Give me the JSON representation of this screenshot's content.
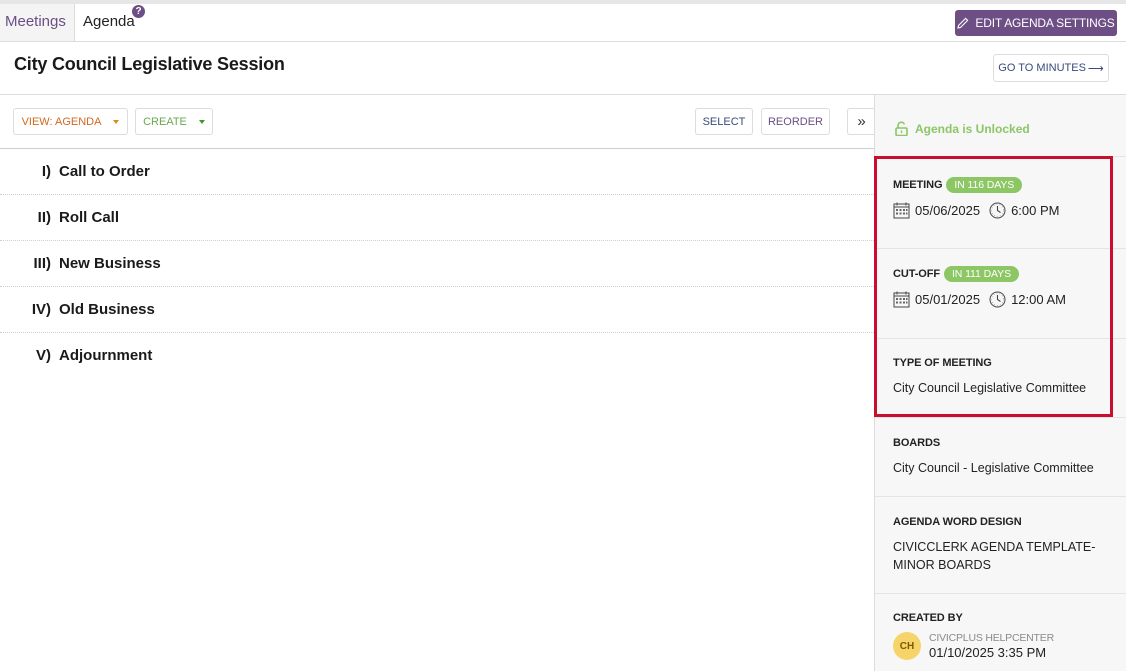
{
  "tabs": {
    "meetings": "Meetings",
    "agenda": "Agenda",
    "help_badge": "?"
  },
  "header": {
    "edit_settings_label": "EDIT AGENDA SETTINGS",
    "edit_settings_icon": "pencil-icon",
    "title": "City Council Legislative Session",
    "goto_minutes_label": "GO TO MINUTES",
    "goto_minutes_arrow": "⟶"
  },
  "toolbar": {
    "view_label": "VIEW: AGENDA",
    "create_label": "CREATE",
    "select_label": "SELECT",
    "reorder_label": "REORDER",
    "collapse_label": "»"
  },
  "agenda_items": [
    {
      "number": "I)",
      "title": "Call to Order"
    },
    {
      "number": "II)",
      "title": "Roll Call"
    },
    {
      "number": "III)",
      "title": "New Business"
    },
    {
      "number": "IV)",
      "title": "Old Business"
    },
    {
      "number": "V)",
      "title": "Adjournment"
    }
  ],
  "sidebar": {
    "lock_status": "Agenda is Unlocked",
    "meeting": {
      "label": "MEETING",
      "badge": "IN 116 DAYS",
      "date": "05/06/2025",
      "time": "6:00 PM"
    },
    "cutoff": {
      "label": "CUT-OFF",
      "badge": "IN 111 DAYS",
      "date": "05/01/2025",
      "time": "12:00 AM"
    },
    "type_of_meeting": {
      "label": "TYPE OF MEETING",
      "value": "City Council Legislative Committee"
    },
    "boards": {
      "label": "BOARDS",
      "value": "City Council - Legislative Committee"
    },
    "word_design": {
      "label": "AGENDA WORD DESIGN",
      "value_line1": "CIVICCLERK AGENDA TEMPLATE-",
      "value_line2": "MINOR BOARDS"
    },
    "created_by": {
      "label": "CREATED BY",
      "initials": "CH",
      "name": "CIVICPLUS HELPCENTER",
      "datetime": "01/10/2025 3:35 PM"
    }
  },
  "colors": {
    "accent_purple": "#6d4f86",
    "status_green": "#8cc665",
    "highlight_red": "#c8102e",
    "view_orange": "#d2691e",
    "create_green": "#6aa84f"
  }
}
